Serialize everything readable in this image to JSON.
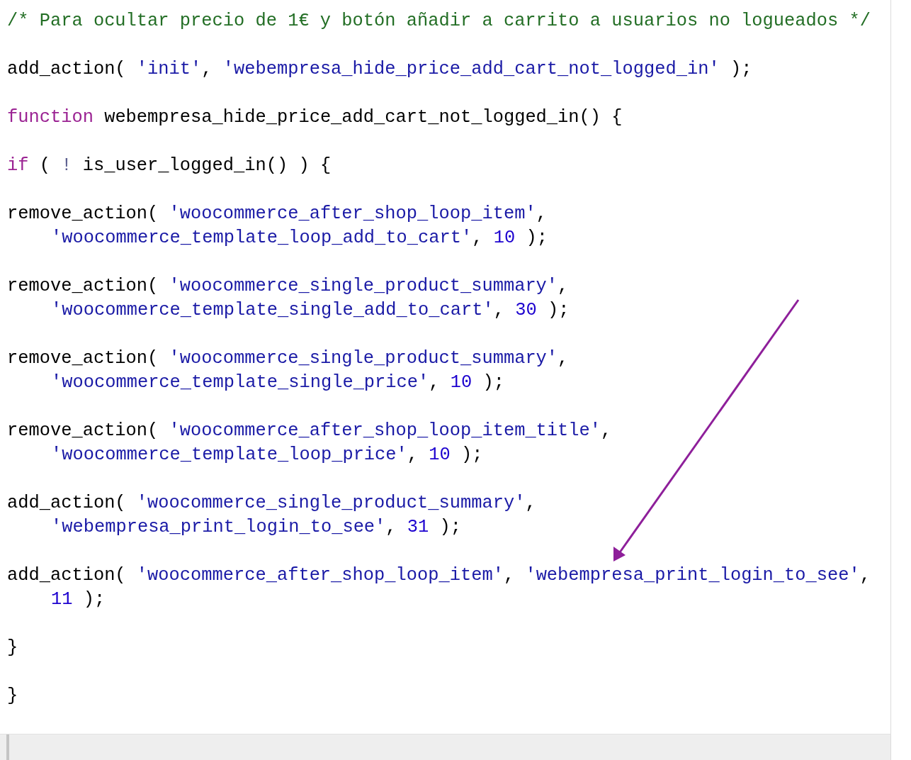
{
  "code_blocks": [
    {
      "lines": [
        {
          "indent": false,
          "tokens": [
            {
              "kind": "comment",
              "text": "/* Para ocultar precio de 1€ y botón añadir a carrito a usuarios no logueados */"
            }
          ]
        }
      ]
    },
    {
      "lines": [
        {
          "indent": false,
          "tokens": [
            {
              "kind": "plain",
              "text": "add_action( "
            },
            {
              "kind": "string",
              "text": "'init'"
            },
            {
              "kind": "plain",
              "text": ", "
            },
            {
              "kind": "string",
              "text": "'webempresa_hide_price_add_cart_not_logged_in'"
            },
            {
              "kind": "plain",
              "text": " );"
            }
          ]
        }
      ]
    },
    {
      "lines": [
        {
          "indent": false,
          "tokens": [
            {
              "kind": "keyword",
              "text": "function"
            },
            {
              "kind": "plain",
              "text": " webempresa_hide_price_add_cart_not_logged_in() {"
            }
          ]
        }
      ]
    },
    {
      "lines": [
        {
          "indent": false,
          "tokens": [
            {
              "kind": "keyword",
              "text": "if"
            },
            {
              "kind": "plain",
              "text": " ( "
            },
            {
              "kind": "operator",
              "text": "!"
            },
            {
              "kind": "plain",
              "text": " is_user_logged_in() ) {"
            }
          ]
        }
      ]
    },
    {
      "lines": [
        {
          "indent": false,
          "tokens": [
            {
              "kind": "plain",
              "text": "remove_action( "
            },
            {
              "kind": "string",
              "text": "'woocommerce_after_shop_loop_item'"
            },
            {
              "kind": "plain",
              "text": ","
            }
          ]
        },
        {
          "indent": true,
          "tokens": [
            {
              "kind": "string",
              "text": "'woocommerce_template_loop_add_to_cart'"
            },
            {
              "kind": "plain",
              "text": ", "
            },
            {
              "kind": "number",
              "text": "10"
            },
            {
              "kind": "plain",
              "text": " );"
            }
          ]
        }
      ]
    },
    {
      "lines": [
        {
          "indent": false,
          "tokens": [
            {
              "kind": "plain",
              "text": "remove_action( "
            },
            {
              "kind": "string",
              "text": "'woocommerce_single_product_summary'"
            },
            {
              "kind": "plain",
              "text": ","
            }
          ]
        },
        {
          "indent": true,
          "tokens": [
            {
              "kind": "string",
              "text": "'woocommerce_template_single_add_to_cart'"
            },
            {
              "kind": "plain",
              "text": ", "
            },
            {
              "kind": "number",
              "text": "30"
            },
            {
              "kind": "plain",
              "text": " );"
            }
          ]
        }
      ]
    },
    {
      "lines": [
        {
          "indent": false,
          "tokens": [
            {
              "kind": "plain",
              "text": "remove_action( "
            },
            {
              "kind": "string",
              "text": "'woocommerce_single_product_summary'"
            },
            {
              "kind": "plain",
              "text": ","
            }
          ]
        },
        {
          "indent": true,
          "tokens": [
            {
              "kind": "string",
              "text": "'woocommerce_template_single_price'"
            },
            {
              "kind": "plain",
              "text": ", "
            },
            {
              "kind": "number",
              "text": "10"
            },
            {
              "kind": "plain",
              "text": " );"
            }
          ]
        }
      ]
    },
    {
      "lines": [
        {
          "indent": false,
          "tokens": [
            {
              "kind": "plain",
              "text": "remove_action( "
            },
            {
              "kind": "string",
              "text": "'woocommerce_after_shop_loop_item_title'"
            },
            {
              "kind": "plain",
              "text": ","
            }
          ]
        },
        {
          "indent": true,
          "tokens": [
            {
              "kind": "string",
              "text": "'woocommerce_template_loop_price'"
            },
            {
              "kind": "plain",
              "text": ", "
            },
            {
              "kind": "number",
              "text": "10"
            },
            {
              "kind": "plain",
              "text": " );"
            }
          ]
        }
      ]
    },
    {
      "lines": [
        {
          "indent": false,
          "tokens": [
            {
              "kind": "plain",
              "text": "add_action( "
            },
            {
              "kind": "string",
              "text": "'woocommerce_single_product_summary'"
            },
            {
              "kind": "plain",
              "text": ","
            }
          ]
        },
        {
          "indent": true,
          "tokens": [
            {
              "kind": "string",
              "text": "'webempresa_print_login_to_see'"
            },
            {
              "kind": "plain",
              "text": ", "
            },
            {
              "kind": "number",
              "text": "31"
            },
            {
              "kind": "plain",
              "text": " );"
            }
          ]
        }
      ]
    },
    {
      "lines": [
        {
          "indent": false,
          "tokens": [
            {
              "kind": "plain",
              "text": "add_action( "
            },
            {
              "kind": "string",
              "text": "'woocommerce_after_shop_loop_item'"
            },
            {
              "kind": "plain",
              "text": ", "
            },
            {
              "kind": "string",
              "text": "'webempresa_print_login_to_see'"
            },
            {
              "kind": "plain",
              "text": ","
            }
          ]
        },
        {
          "indent": true,
          "tokens": [
            {
              "kind": "number",
              "text": "11"
            },
            {
              "kind": "plain",
              "text": " );"
            }
          ]
        }
      ]
    },
    {
      "lines": [
        {
          "indent": false,
          "tokens": [
            {
              "kind": "plain",
              "text": "}"
            }
          ]
        }
      ]
    },
    {
      "lines": [
        {
          "indent": false,
          "tokens": [
            {
              "kind": "plain",
              "text": "}"
            }
          ]
        }
      ]
    }
  ]
}
